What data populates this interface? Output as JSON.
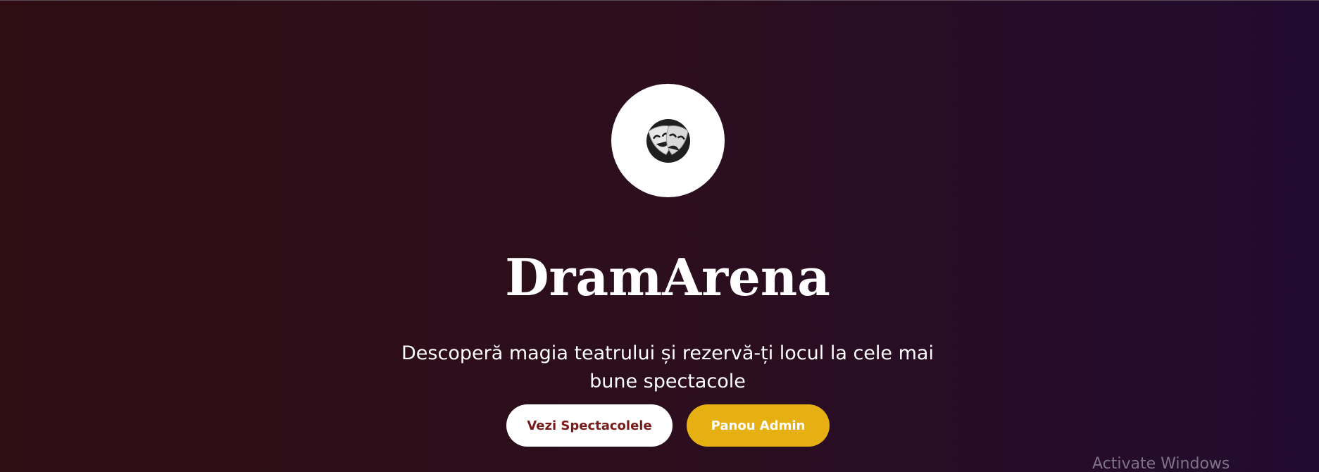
{
  "hero": {
    "logo_icon": "theater-masks-icon",
    "title": "DramArena",
    "tagline": "Descoperă magia teatrului și rezervă-ți locul la cele mai bune spectacole"
  },
  "buttons": {
    "primary_label": "Vezi Spectacolele",
    "admin_label": "Panou Admin"
  },
  "os_overlay": {
    "watermark": "Activate Windows"
  },
  "colors": {
    "background_left": "#2f0d13",
    "background_right": "#220b30",
    "primary_button_bg": "#ffffff",
    "primary_button_text": "#7a1b1b",
    "admin_button_bg": "#e6b012",
    "admin_button_text": "#ffffff"
  }
}
